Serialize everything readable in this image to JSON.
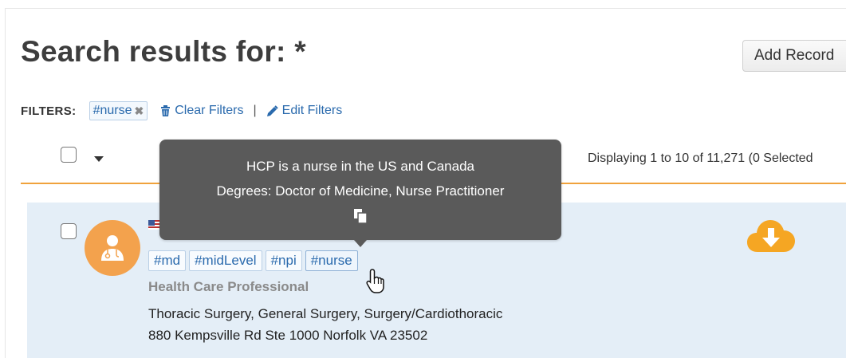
{
  "page": {
    "title": "Search results for: *",
    "add_record_label": "Add Record"
  },
  "filters": {
    "label": "FILTERS:",
    "active_tag": "#nurse",
    "clear_label": "Clear Filters",
    "separator": "|",
    "edit_label": "Edit Filters"
  },
  "list_header": {
    "display_count": "Displaying 1 to 10 of 11,271 (0 Selected"
  },
  "tooltip": {
    "line1": "HCP is a nurse in the US and Canada",
    "line2": "Degrees: Doctor of Medicine, Nurse Practitioner"
  },
  "result": {
    "tags": [
      "#md",
      "#midLevel",
      "#npi",
      "#nurse"
    ],
    "type": "Health Care Professional",
    "specialties": "Thoracic Surgery, General Surgery, Surgery/Cardiothoracic",
    "address": "880 Kempsville Rd Ste 1000 Norfolk VA 23502"
  },
  "colors": {
    "accent_orange": "#f0a23c",
    "link_blue": "#2a6aad",
    "row_bg": "#e4eef7",
    "tooltip_bg": "#5a5a5a"
  },
  "icons": [
    "trash-icon",
    "pencil-icon",
    "remove-x-icon",
    "chevron-down-icon",
    "hcp-avatar-icon",
    "us-flag-icon",
    "cloud-download-icon",
    "copy-icon",
    "hand-cursor-icon"
  ]
}
